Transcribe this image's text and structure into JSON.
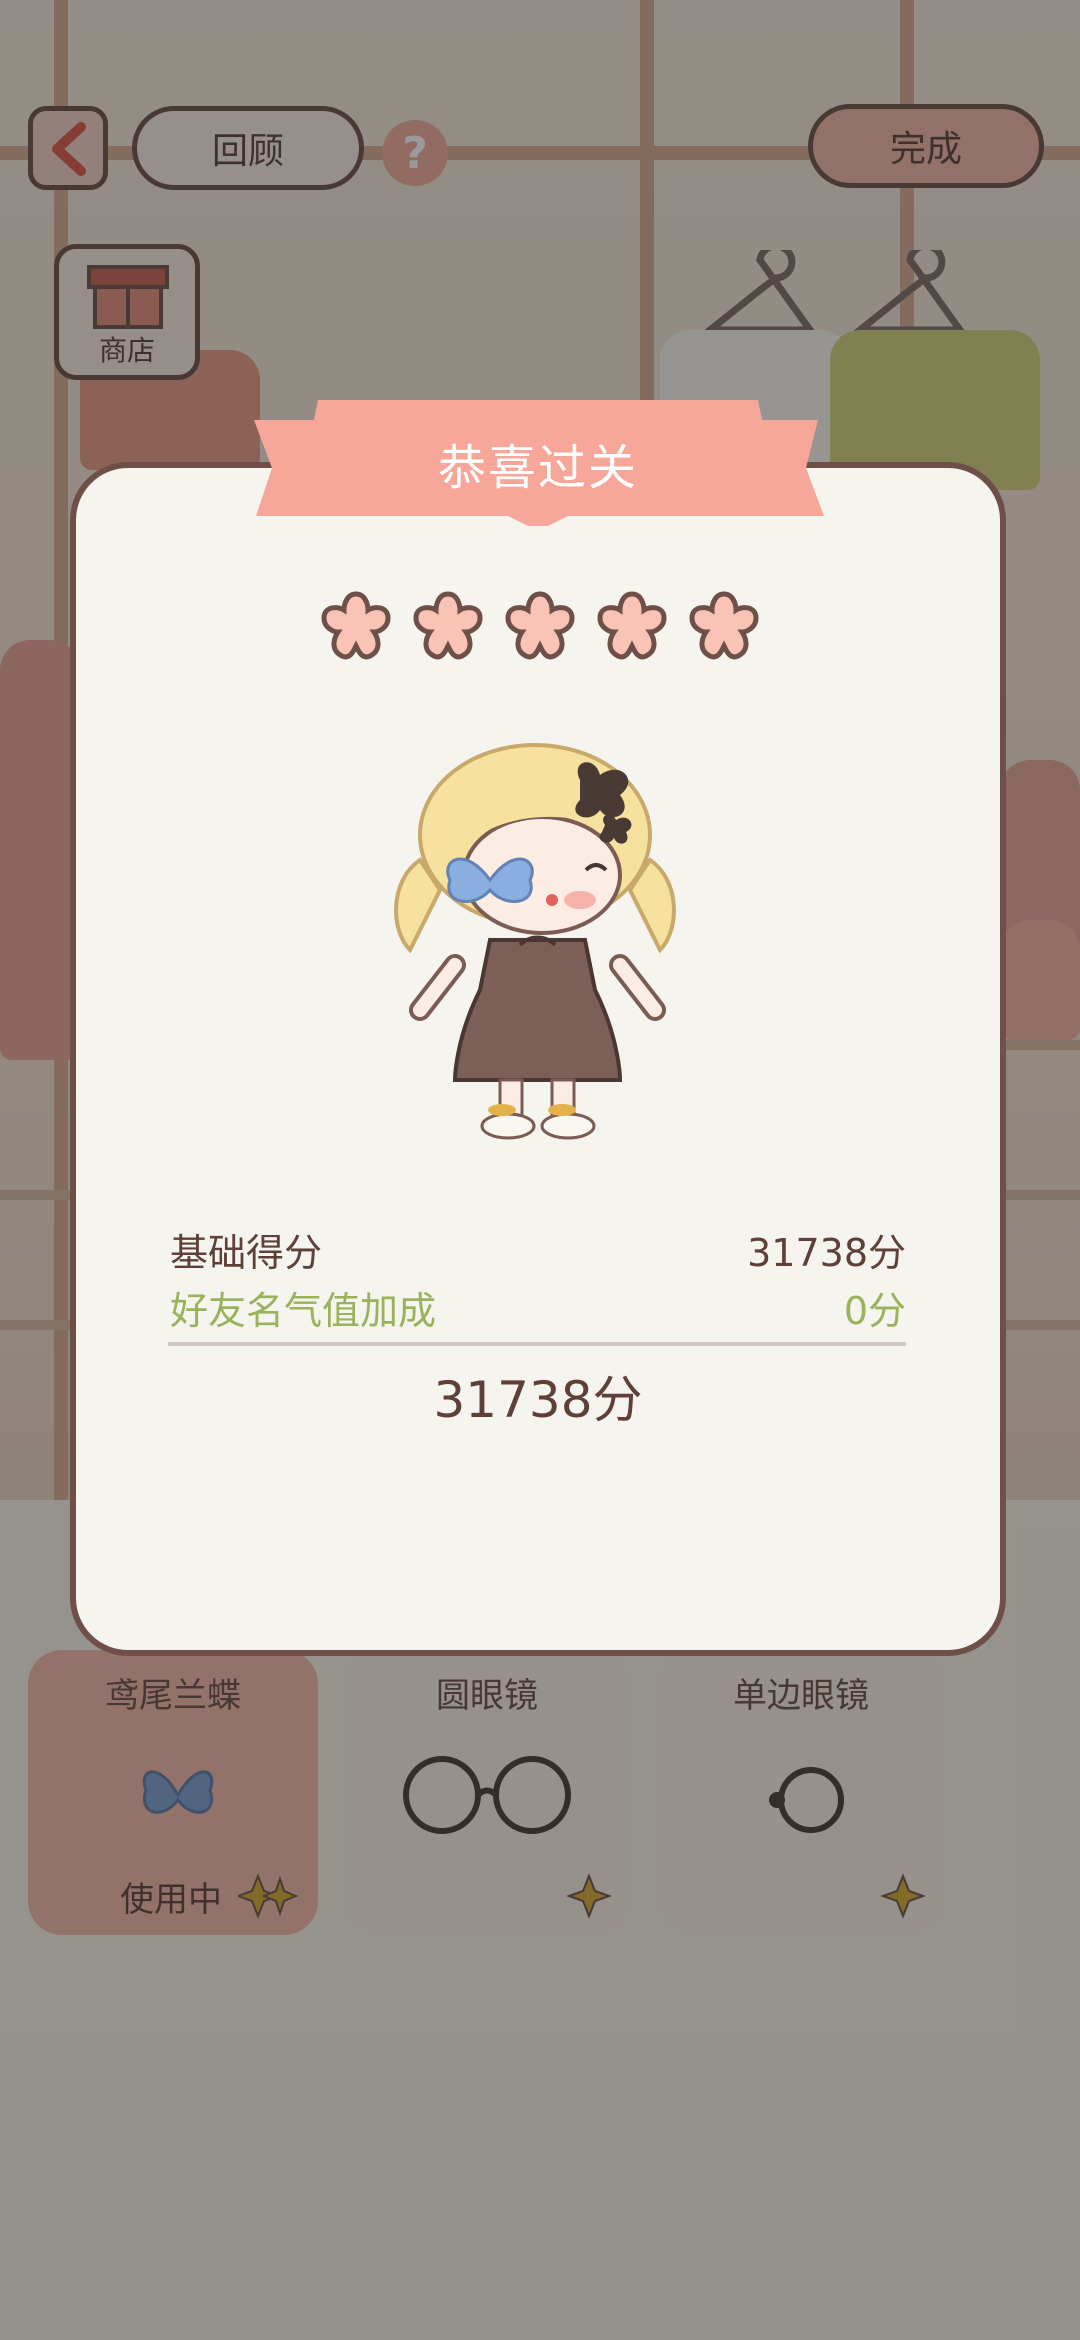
{
  "topbar": {
    "back_icon": "chevron-left-icon",
    "review_label": "回顾",
    "help_icon": "question-icon",
    "help_glyph": "?",
    "done_label": "完成",
    "shop_label": "商店",
    "shop_icon": "shop-icon"
  },
  "items": [
    {
      "name": "鸢尾兰蝶",
      "status": "使用中",
      "icon": "butterfly-icon"
    },
    {
      "name": "圆眼镜",
      "status": "",
      "icon": "round-glasses-icon"
    },
    {
      "name": "单边眼镜",
      "status": "",
      "icon": "monocle-icon"
    }
  ],
  "dialog": {
    "title": "恭喜过关",
    "stars_earned": 5,
    "stars_total": 5,
    "base_score_label": "基础得分",
    "base_score_value": "31738分",
    "bonus_label": "好友名气值加成",
    "bonus_value": "0分",
    "total_value": "31738分"
  },
  "colors": {
    "banner": "#f7a69a",
    "star": "#f9c3b6",
    "outline": "#6e5048",
    "bonus_text": "#9ab25a",
    "dialog_bg": "#f6f4ef"
  }
}
